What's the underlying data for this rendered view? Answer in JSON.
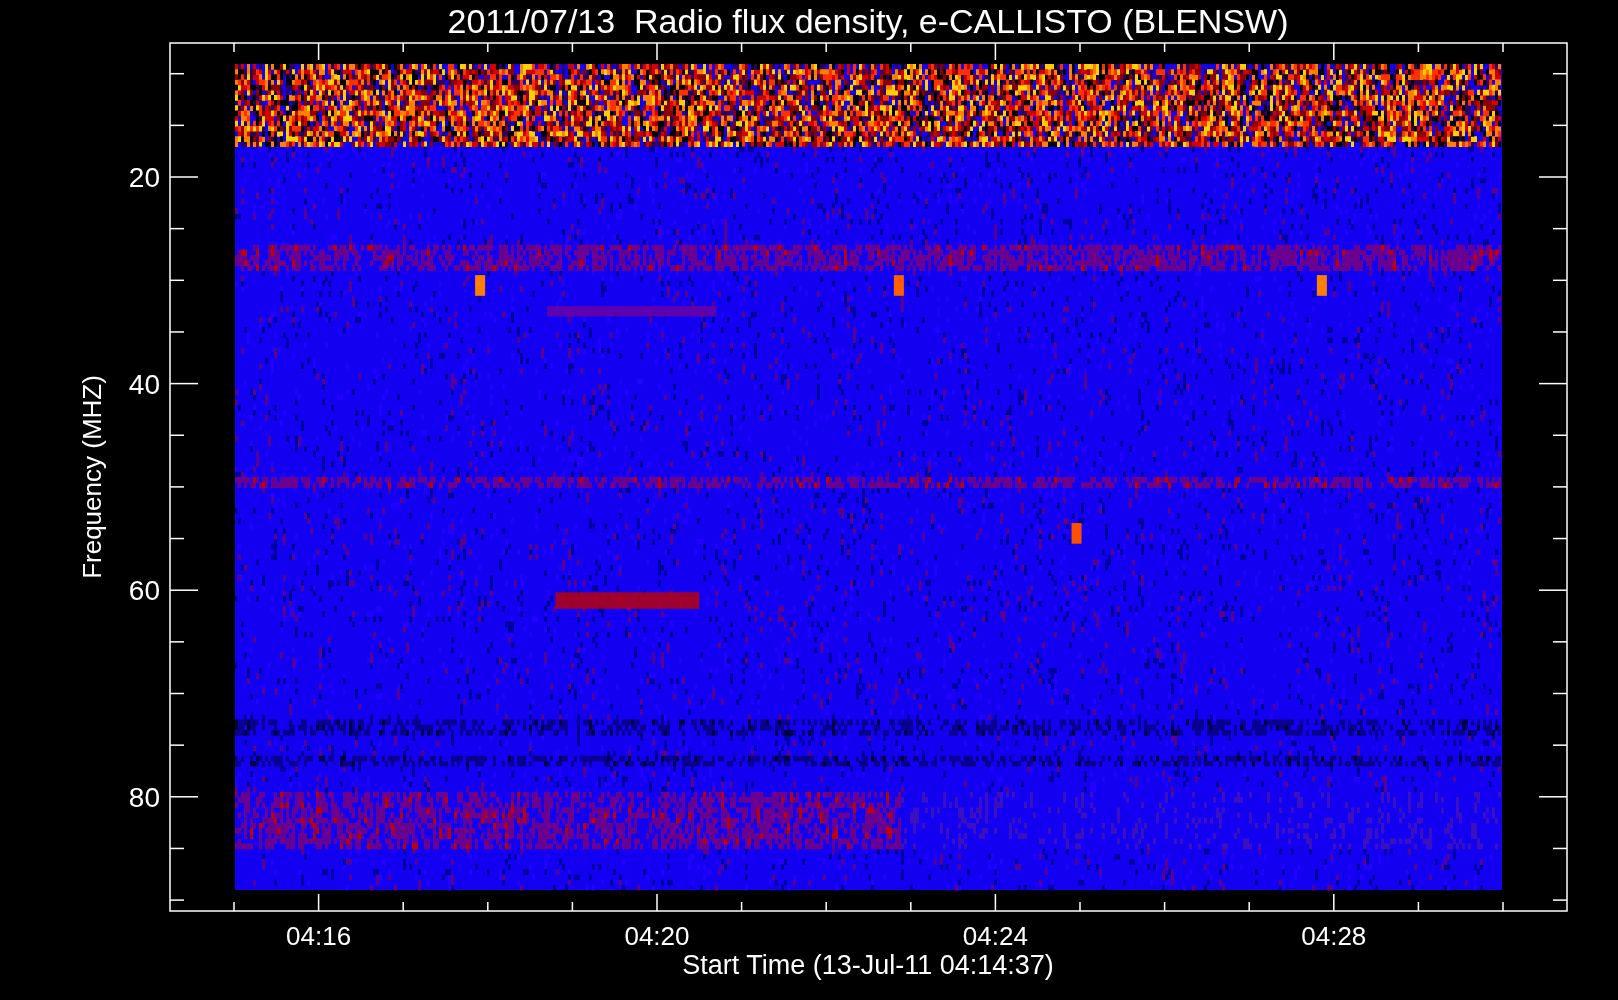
{
  "title": "2011/07/13  Radio flux density, e-CALLISTO (BLENSW)",
  "ylabel": "Frequency (MHZ)",
  "xlabel": "Start Time (13-Jul-11 04:14:37)",
  "yticks": [
    "20",
    "40",
    "60",
    "80"
  ],
  "xticks": [
    "04:16",
    "04:20",
    "04:24",
    "04:28"
  ]
}
